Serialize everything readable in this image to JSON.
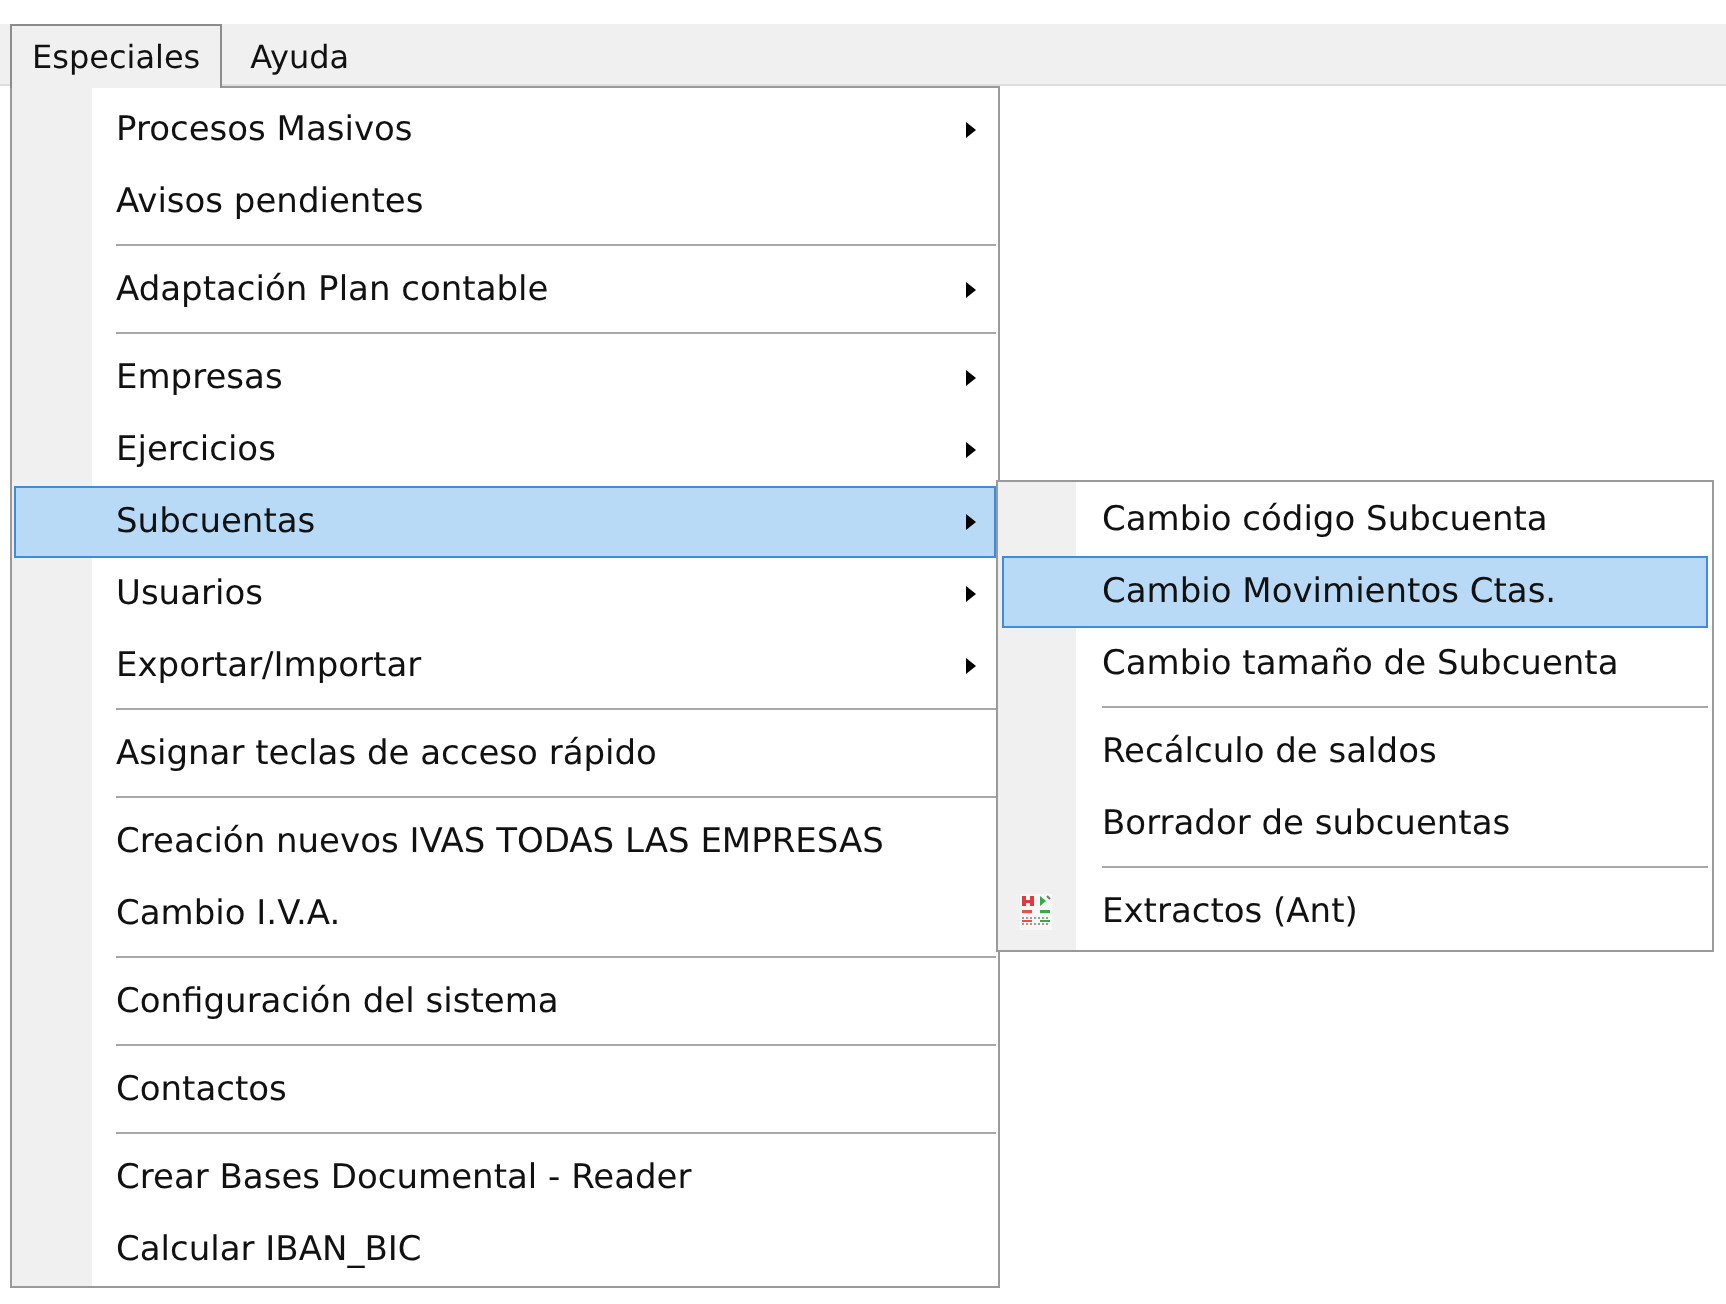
{
  "menu_bar": [
    {
      "label": "Especiales",
      "selected": true
    },
    {
      "label": "Ayuda",
      "selected": false
    }
  ],
  "menu": {
    "items": [
      {
        "kind": "item",
        "label": "Procesos Masivos",
        "has_submenu": true,
        "selected": false
      },
      {
        "kind": "item",
        "label": "Avisos pendientes",
        "has_submenu": false,
        "selected": false
      },
      {
        "kind": "separator"
      },
      {
        "kind": "item",
        "label": "Adaptación Plan contable",
        "has_submenu": true,
        "selected": false
      },
      {
        "kind": "separator"
      },
      {
        "kind": "item",
        "label": "Empresas",
        "has_submenu": true,
        "selected": false
      },
      {
        "kind": "item",
        "label": "Ejercicios",
        "has_submenu": true,
        "selected": false
      },
      {
        "kind": "item",
        "label": "Subcuentas",
        "has_submenu": true,
        "selected": true,
        "submenu": {
          "items": [
            {
              "kind": "item",
              "label": "Cambio código Subcuenta",
              "has_icon": false,
              "selected": false
            },
            {
              "kind": "item",
              "label": "Cambio Movimientos Ctas.",
              "has_icon": false,
              "selected": true
            },
            {
              "kind": "item",
              "label": "Cambio tamaño de Subcuenta",
              "has_icon": false,
              "selected": false
            },
            {
              "kind": "separator"
            },
            {
              "kind": "item",
              "label": "Recálculo de saldos",
              "has_icon": false,
              "selected": false
            },
            {
              "kind": "item",
              "label": "Borrador de subcuentas",
              "has_icon": false,
              "selected": false
            },
            {
              "kind": "separator"
            },
            {
              "kind": "item",
              "label": "Extractos (Ant)",
              "has_icon": true,
              "selected": false
            }
          ]
        }
      },
      {
        "kind": "item",
        "label": "Usuarios",
        "has_submenu": true,
        "selected": false
      },
      {
        "kind": "item",
        "label": "Exportar/Importar",
        "has_submenu": true,
        "selected": false
      },
      {
        "kind": "separator"
      },
      {
        "kind": "item",
        "label": "Asignar teclas de acceso rápido",
        "has_submenu": false,
        "selected": false
      },
      {
        "kind": "separator"
      },
      {
        "kind": "item",
        "label": "Creación nuevos IVAS TODAS LAS EMPRESAS",
        "has_submenu": false,
        "selected": false
      },
      {
        "kind": "item",
        "label": "Cambio I.V.A.",
        "has_submenu": false,
        "selected": false
      },
      {
        "kind": "separator"
      },
      {
        "kind": "item",
        "label": "Configuración del sistema",
        "has_submenu": false,
        "selected": false
      },
      {
        "kind": "separator"
      },
      {
        "kind": "item",
        "label": "Contactos",
        "has_submenu": false,
        "selected": false
      },
      {
        "kind": "separator"
      },
      {
        "kind": "item",
        "label": "Crear Bases Documental - Reader",
        "has_submenu": false,
        "selected": false
      },
      {
        "kind": "item",
        "label": "Calcular IBAN_BIC",
        "has_submenu": false,
        "selected": false
      }
    ]
  }
}
